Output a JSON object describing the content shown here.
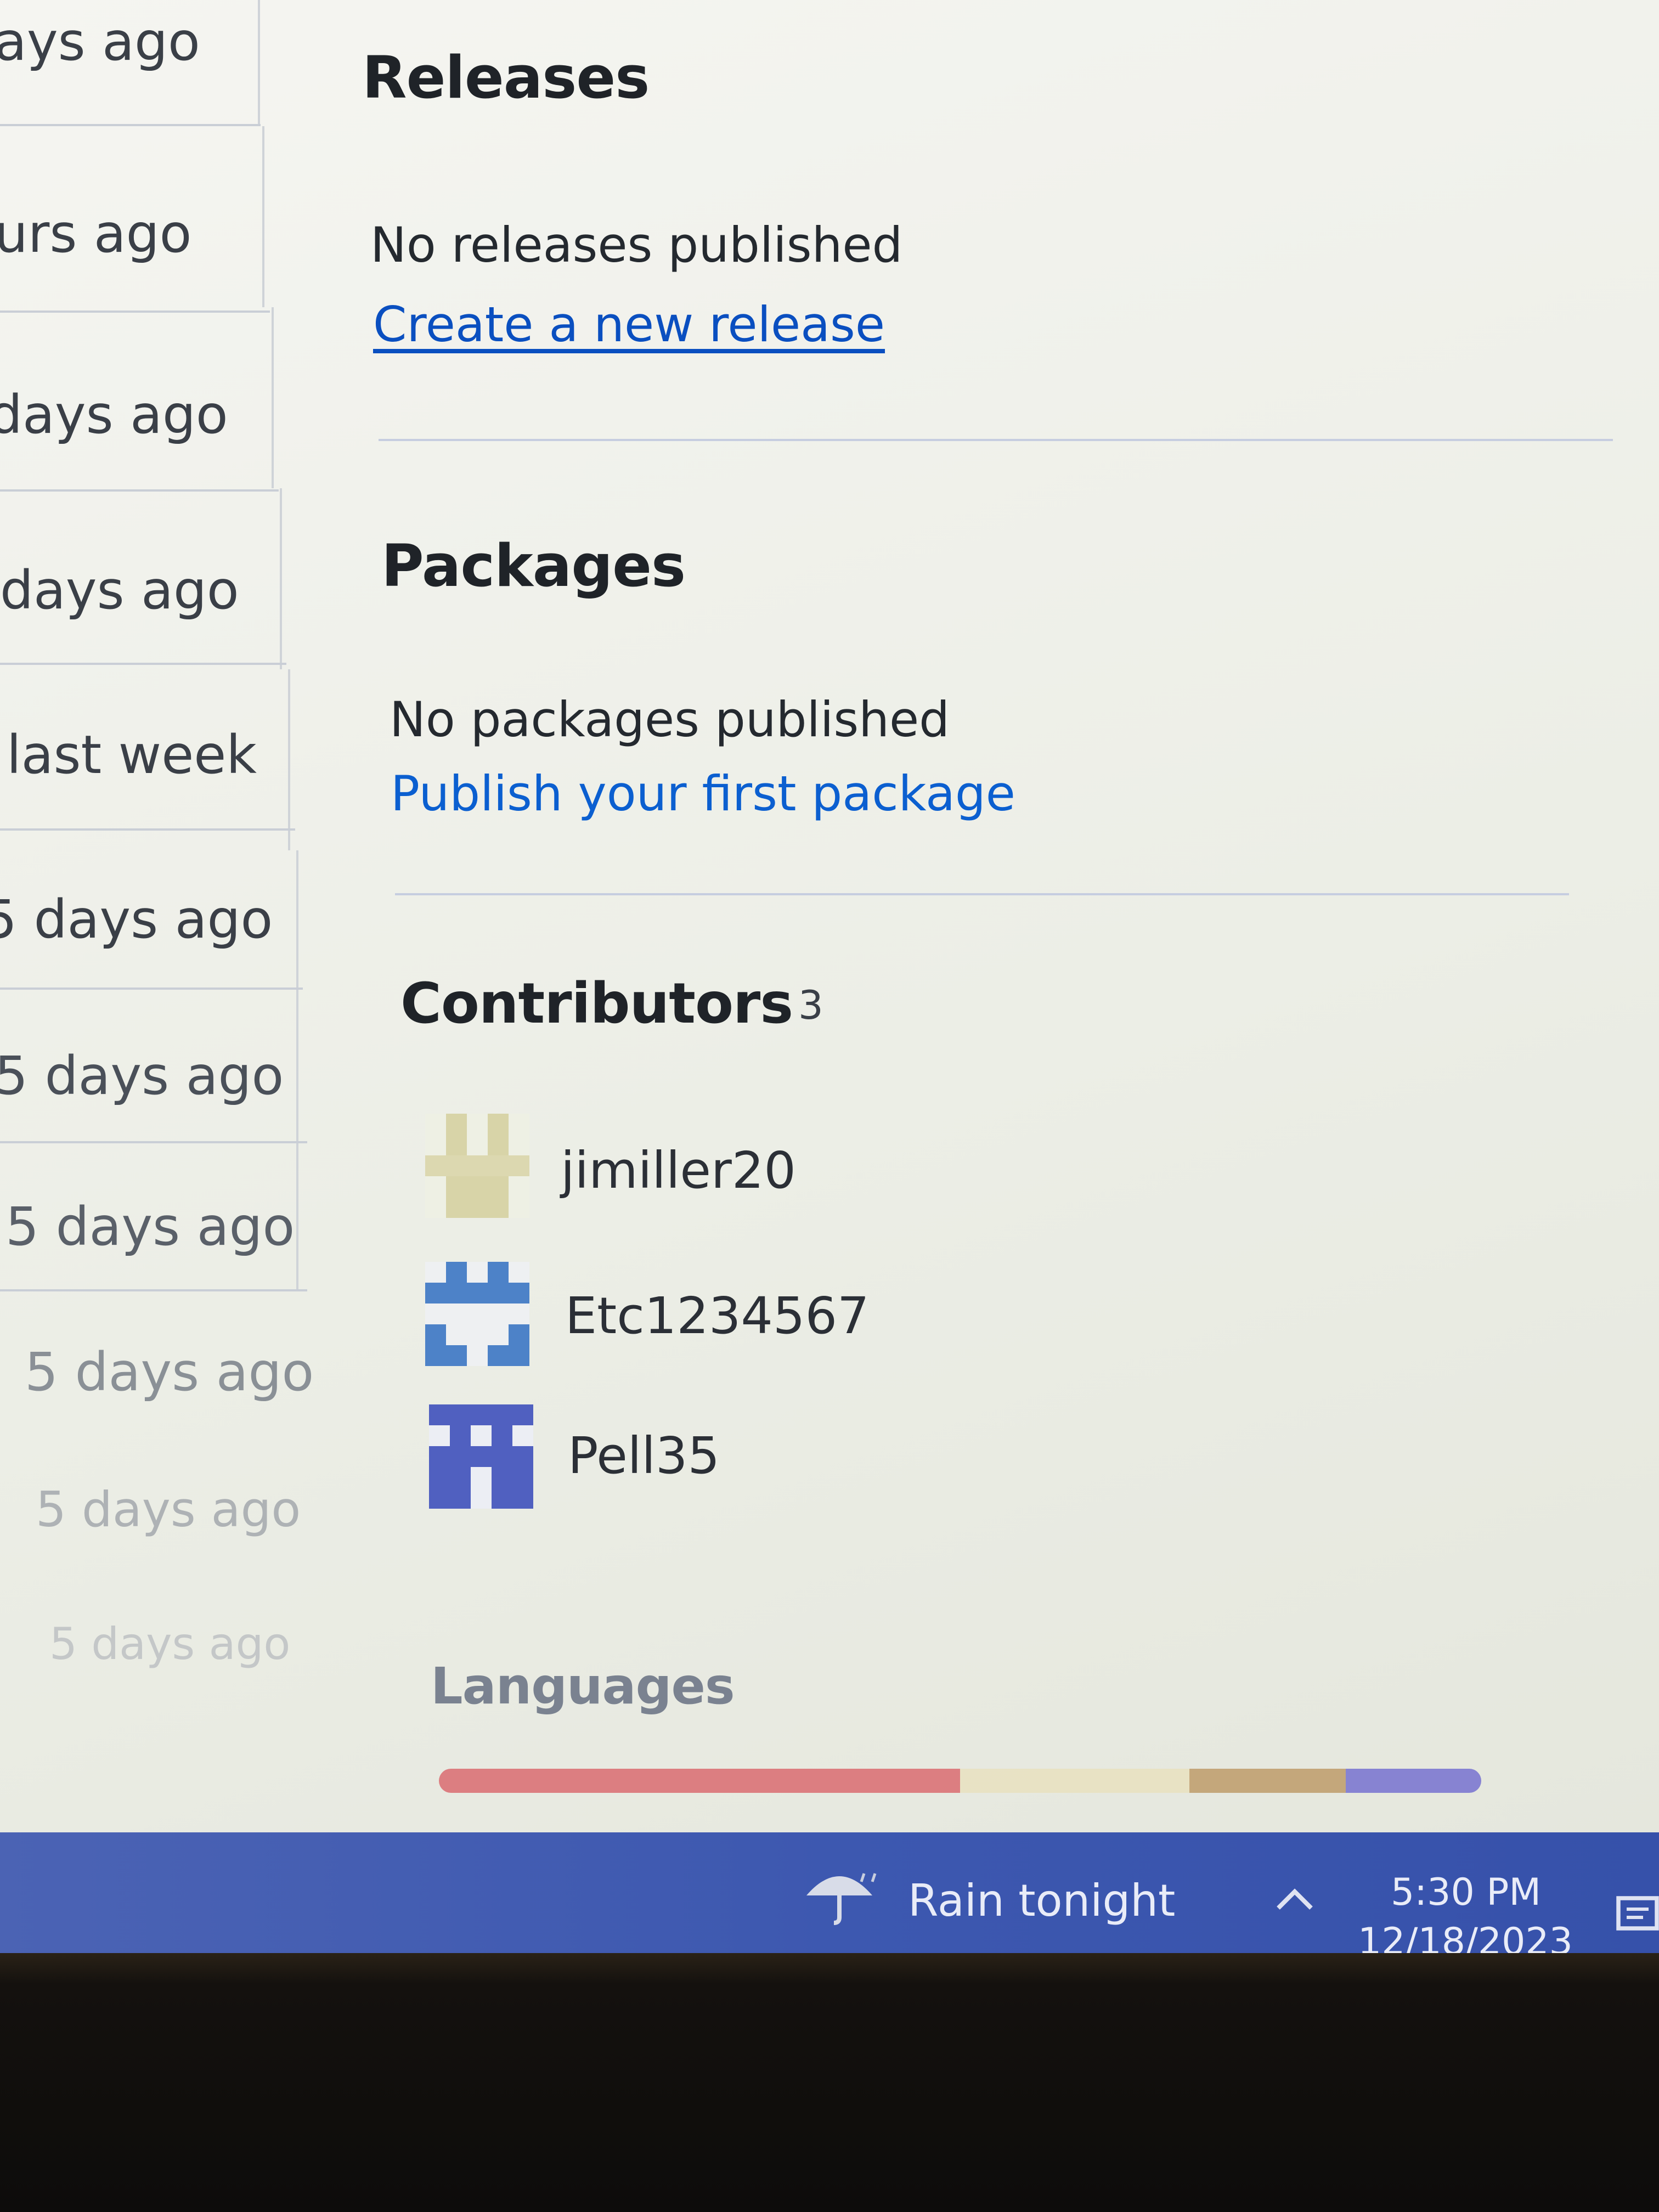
{
  "commit_times": [
    "ays ago",
    "urs ago",
    "days ago",
    "days ago",
    "last week",
    "5 days ago",
    "5 days ago",
    "5 days ago",
    "5 days ago",
    "5 days ago",
    "5 days ago"
  ],
  "releases": {
    "heading": "Releases",
    "status": "No releases published",
    "link": "Create a new release"
  },
  "packages": {
    "heading": "Packages",
    "status": "No packages published",
    "link": "Publish your first package"
  },
  "contributors": {
    "heading": "Contributors",
    "count": "3",
    "users": [
      {
        "name": "jimiller20",
        "avatar": "identicon-avatar",
        "color": "#d8d4a8"
      },
      {
        "name": "Etc1234567",
        "avatar": "identicon-avatar",
        "color": "#4d82c8"
      },
      {
        "name": "Pell35",
        "avatar": "identicon-avatar",
        "color": "#5060c0"
      }
    ]
  },
  "languages": {
    "heading": "Languages",
    "segments": [
      {
        "color": "#e34c26",
        "share": 0.5
      },
      {
        "color": "#f1e05a",
        "share": 0.22
      },
      {
        "color": "#c8a040",
        "share": 0.15
      },
      {
        "color": "#563d7c",
        "share": 0.13
      }
    ]
  },
  "taskbar": {
    "weather_icon": "umbrella-rain-icon",
    "weather": "Rain tonight",
    "tray_icon": "chevron-up-icon",
    "time": "5:30 PM",
    "date": "12/18/2023",
    "notification_icon": "notification-icon",
    "background": "#3d58b0"
  }
}
